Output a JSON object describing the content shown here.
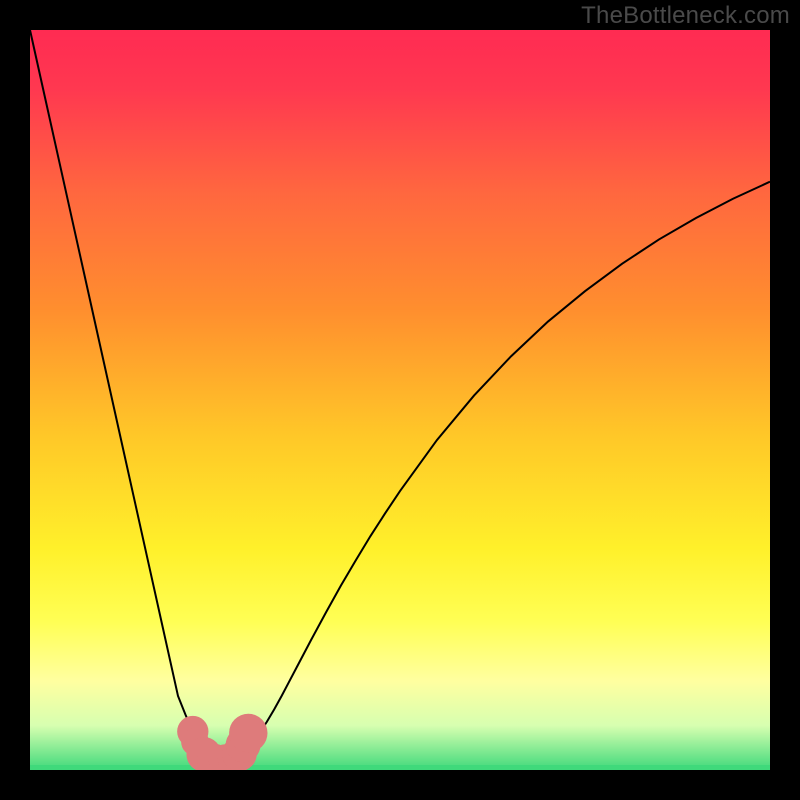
{
  "watermark": "TheBottleneck.com",
  "palette": {
    "black": "#000000",
    "curve_stroke": "#000000",
    "dot_fill": "#de7b7b",
    "baseline": "#3fd97b",
    "gradient_stops": [
      {
        "offset": 0.0,
        "color": "#ff2b52"
      },
      {
        "offset": 0.08,
        "color": "#ff3850"
      },
      {
        "offset": 0.22,
        "color": "#ff673f"
      },
      {
        "offset": 0.38,
        "color": "#ff8f2e"
      },
      {
        "offset": 0.55,
        "color": "#ffc828"
      },
      {
        "offset": 0.7,
        "color": "#fff02a"
      },
      {
        "offset": 0.8,
        "color": "#ffff55"
      },
      {
        "offset": 0.88,
        "color": "#ffffa0"
      },
      {
        "offset": 0.94,
        "color": "#d7ffb0"
      },
      {
        "offset": 1.0,
        "color": "#3fd97b"
      }
    ]
  },
  "chart_data": {
    "type": "line",
    "title": "",
    "xlabel": "",
    "ylabel": "",
    "xlim": [
      0,
      100
    ],
    "ylim": [
      0,
      100
    ],
    "x": [
      0,
      2,
      4,
      6,
      8,
      10,
      12,
      14,
      16,
      18,
      20,
      21,
      22,
      23,
      23.5,
      24,
      24.5,
      25,
      25.5,
      26,
      26.5,
      27,
      27.5,
      28,
      28.5,
      29,
      30,
      31,
      32,
      33,
      34,
      35,
      36,
      38,
      40,
      42,
      44,
      46,
      48,
      50,
      55,
      60,
      65,
      70,
      75,
      80,
      85,
      90,
      95,
      100
    ],
    "values": [
      100,
      91,
      82,
      73,
      64,
      55,
      46,
      37,
      28,
      19,
      10,
      7.5,
      5.2,
      3.3,
      2.6,
      2.1,
      1.7,
      1.4,
      1.3,
      1.25,
      1.25,
      1.3,
      1.4,
      1.7,
      2.1,
      2.6,
      3.7,
      5.0,
      6.5,
      8.2,
      10.0,
      11.9,
      13.8,
      17.6,
      21.3,
      24.9,
      28.3,
      31.6,
      34.7,
      37.7,
      44.6,
      50.6,
      55.9,
      60.6,
      64.7,
      68.4,
      71.7,
      74.6,
      77.2,
      79.5
    ],
    "annotations_dots": [
      {
        "x": 22.0,
        "y": 5.2,
        "r": 1.2
      },
      {
        "x": 22.3,
        "y": 3.8,
        "r": 1.0
      },
      {
        "x": 23.5,
        "y": 2.1,
        "r": 1.4
      },
      {
        "x": 24.8,
        "y": 1.35,
        "r": 1.3
      },
      {
        "x": 26.4,
        "y": 1.25,
        "r": 1.3
      },
      {
        "x": 27.6,
        "y": 1.55,
        "r": 1.3
      },
      {
        "x": 28.3,
        "y": 2.2,
        "r": 1.4
      },
      {
        "x": 28.8,
        "y": 3.4,
        "r": 1.4
      },
      {
        "x": 29.5,
        "y": 5.0,
        "r": 1.6
      }
    ],
    "baseline_y": 0.0,
    "notes": "V-shaped bottleneck curve; y is approximate mismatch percent relative to background color scale. Background encodes y-value: ~100 → red, ~0 → green."
  }
}
